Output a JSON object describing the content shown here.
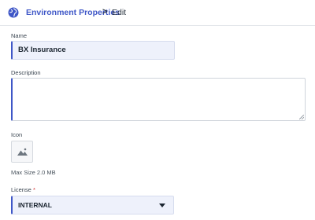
{
  "header": {
    "breadcrumb_link": "Environment Properties",
    "separator": ">",
    "current": "Edit",
    "icon": "globe-icon"
  },
  "form": {
    "name_label": "Name",
    "name_value": "BX Insurance",
    "description_label": "Description",
    "description_value": "",
    "icon_label": "Icon",
    "icon_placeholder": "image-icon",
    "max_size_text": "Max Size 2.0 MB",
    "license_label": "License",
    "license_required_mark": "*",
    "license_value": "INTERNAL"
  },
  "colors": {
    "accent": "#3f57c7",
    "field_bg": "#eef1fb",
    "required": "#d23030"
  }
}
